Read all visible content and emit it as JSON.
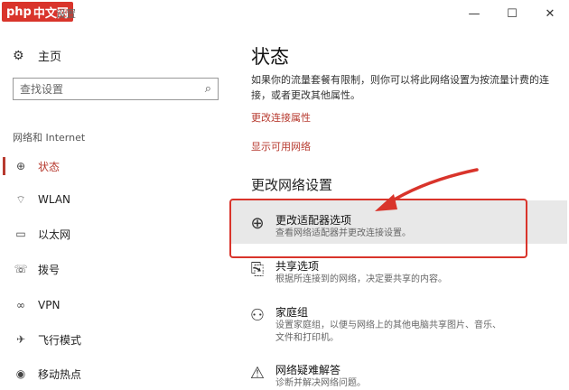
{
  "watermark": {
    "brand": "php",
    "site": "中文网"
  },
  "window": {
    "title": "设置",
    "minimize": "—",
    "maximize": "☐",
    "close": "✕"
  },
  "sidebar": {
    "home_label": "主页",
    "search_placeholder": "查找设置",
    "section_label": "网络和 Internet",
    "items": [
      {
        "label": "状态",
        "icon": "globe-icon",
        "active": true
      },
      {
        "label": "WLAN",
        "icon": "wifi-icon"
      },
      {
        "label": "以太网",
        "icon": "ethernet-icon"
      },
      {
        "label": "拨号",
        "icon": "dialup-icon"
      },
      {
        "label": "VPN",
        "icon": "vpn-icon"
      },
      {
        "label": "飞行模式",
        "icon": "airplane-icon"
      },
      {
        "label": "移动热点",
        "icon": "hotspot-icon"
      }
    ]
  },
  "main": {
    "title": "状态",
    "description": "如果你的流量套餐有限制，则你可以将此网络设置为按流量计费的连接，或者更改其他属性。",
    "links": [
      "更改连接属性",
      "显示可用网络"
    ],
    "section_title": "更改网络设置",
    "options": [
      {
        "title": "更改适配器选项",
        "subtitle": "查看网络适配器并更改连接设置。",
        "icon": "adapter-icon"
      },
      {
        "title": "共享选项",
        "subtitle": "根据所连接到的网络，决定要共享的内容。",
        "icon": "sharing-icon"
      },
      {
        "title": "家庭组",
        "subtitle": "设置家庭组，以便与网络上的其他电脑共享图片、音乐、文件和打印机。",
        "icon": "homegroup-icon"
      },
      {
        "title": "网络疑难解答",
        "subtitle": "诊断并解决网络问题。",
        "icon": "warning-icon"
      }
    ]
  },
  "accent_color": "#b73a2f",
  "annotation_color": "#d9342b"
}
